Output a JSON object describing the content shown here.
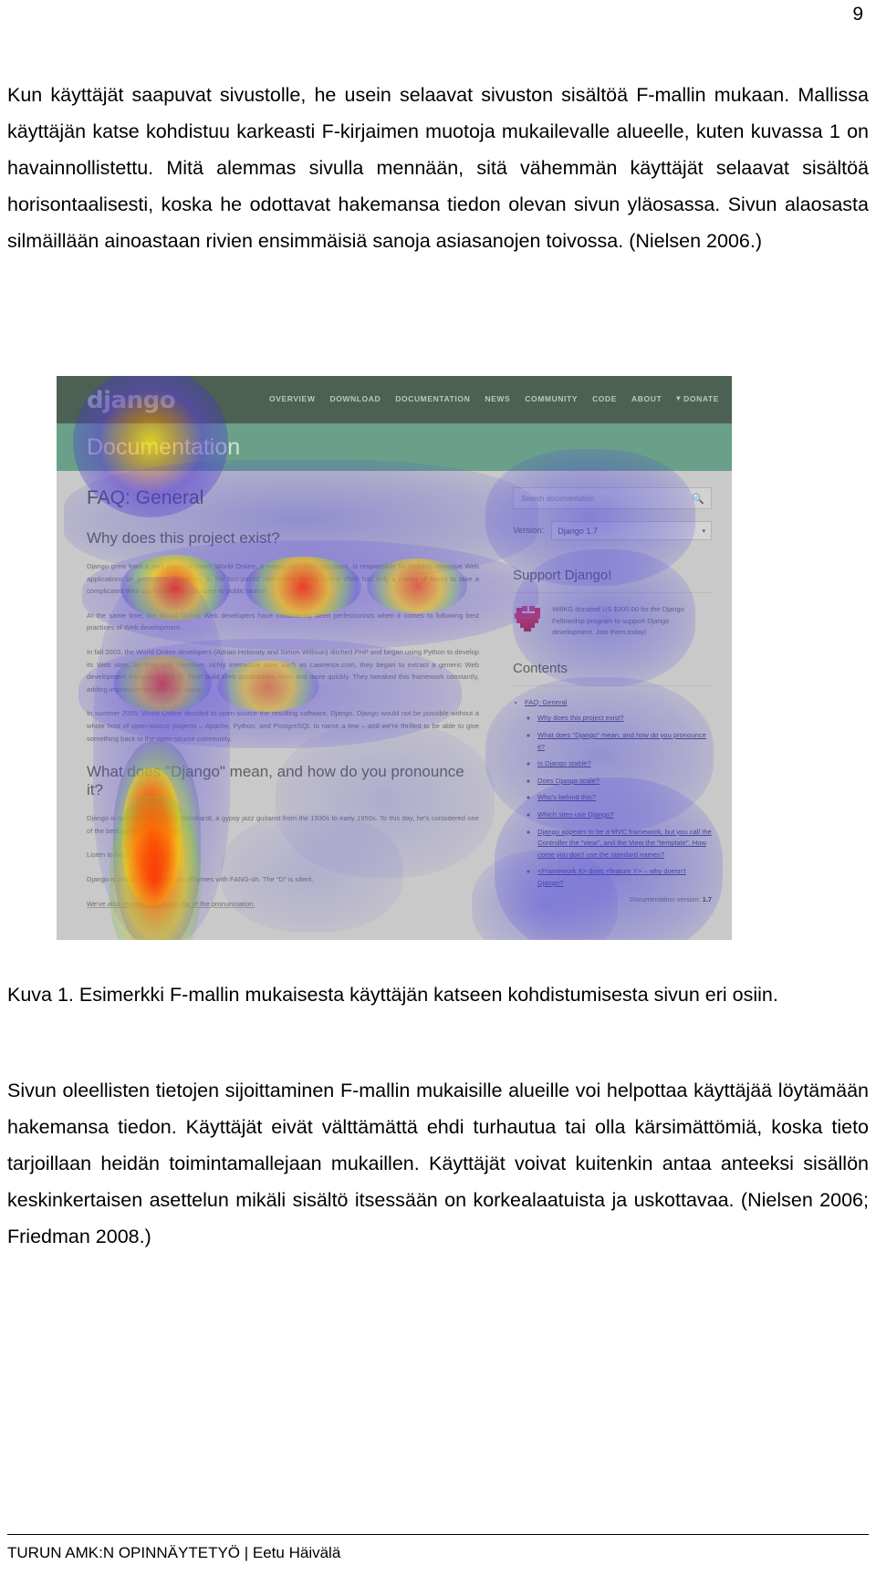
{
  "page": {
    "number": "9"
  },
  "paragraph1": "Kun käyttäjät saapuvat sivustolle, he usein selaavat sivuston sisältöä F-mallin mukaan. Mallissa käyttäjän katse kohdistuu karkeasti F-kirjaimen muotoja mukailevalle alueelle, kuten kuvassa 1 on havainnollistettu. Mitä alemmas sivulla mennään, sitä vähemmän käyttäjät selaavat sisältöä horisontaalisesti, koska he odottavat hakemansa tiedon olevan sivun yläosassa. Sivun alaosasta silmäillään ainoastaan rivien ensimmäisiä sanoja asiasanojen toivossa. (Nielsen 2006.)",
  "caption": "Kuva 1. Esimerkki F-mallin mukaisesta käyttäjän katseen kohdistumisesta sivun eri osiin.",
  "paragraph2": "Sivun oleellisten tietojen sijoittaminen F-mallin mukaisille alueille voi helpottaa käyttäjää löytämään hakemansa tiedon. Käyttäjät eivät välttämättä ehdi turhautua tai olla kärsimättömiä, koska tieto tarjoillaan heidän toimintamallejaan mukaillen. Käyttäjät voivat kuitenkin antaa anteeksi sisällön keskinkertaisen asettelun mikäli sisältö itsessään on korkealaatuista ja uskottavaa. (Nielsen 2006; Friedman 2008.)",
  "footer": "TURUN AMK:N OPINNÄYTETYÖ | Eetu Häivälä",
  "figure": {
    "nav": {
      "logo": "django",
      "items": [
        "OVERVIEW",
        "DOWNLOAD",
        "DOCUMENTATION",
        "NEWS",
        "COMMUNITY",
        "CODE",
        "ABOUT"
      ],
      "donate_label": "DONATE",
      "donate_caret": "▾"
    },
    "subhead_title": "Documentation",
    "main": {
      "page_title": "FAQ: General",
      "section_title": "Why does this project exist?",
      "paragraphs": [
        "Django grew from a very practical need: World Online, a newspaper Web operation, is responsible for building intensive Web applications on journalism deadlines. In the fast-paced newsroom, World Online often has only a matter of hours to take a complicated Web application from concept to public launch.",
        "At the same time, the World Online Web developers have consistently been perfectionists when it comes to following best practices of Web development.",
        "In fall 2003, the World Online developers (Adrian Holovaty and Simon Willison) ditched PHP and began using Python to develop its Web sites. As they built intensive, richly interactive sites such as Lawrence.com, they began to extract a generic Web development framework that let them build Web applications more and more quickly. They tweaked this framework constantly, adding improvements over two years.",
        "In summer 2005, World Online decided to open-source the resulting software, Django. Django would not be possible without a whole host of open-source projects – Apache, Python, and PostgreSQL to name a few – and we're thrilled to be able to give something back to the open-source community."
      ],
      "section2_title": "What does \"Django\" mean, and how do you pronounce it?",
      "paragraphs2": [
        "Django is named after Django Reinhardt, a gypsy jazz guitarist from the 1930s to early 1950s. To this day, he's considered one of the best guitarists of all time.",
        "Listen to his music. You'll like it.",
        "Django is pronounced JANG-oh. Rhymes with FANG-oh. The \"D\" is silent.",
        "We've also recorded an audio clip of the pronunciation."
      ]
    },
    "sidebar": {
      "search_placeholder": "Search documentation",
      "search_icon": "search-icon",
      "version_label": "Version:",
      "version_value": "Django 1.7",
      "version_caret": "▾",
      "support_title": "Support Django!",
      "donation_text": "WillKG donated US $200.00 for the Django Fellowship program to support Django development. Join them today!",
      "contents_title": "Contents",
      "toc": [
        {
          "label": "FAQ: General",
          "children": [
            "Why does this project exist?",
            "What does \"Django\" mean, and how do you pronounce it?",
            "Is Django stable?",
            "Does Django scale?",
            "Who's behind this?",
            "Which sites use Django?",
            "Django appears to be a MVC framework, but you call the Controller the \"view\", and the View the \"template\". How come you don't use the standard names?",
            "<Framework X> does <feature Y> – why doesn't Django?"
          ]
        }
      ],
      "doc_version_label": "Documentation version:",
      "doc_version_value": "1.7"
    },
    "heatmap": {
      "description": "eye-tracking F-pattern heatmap overlay",
      "colors": {
        "hot": "#ff2200",
        "warm": "#ffe000",
        "cool": "#3a34d8"
      }
    }
  }
}
